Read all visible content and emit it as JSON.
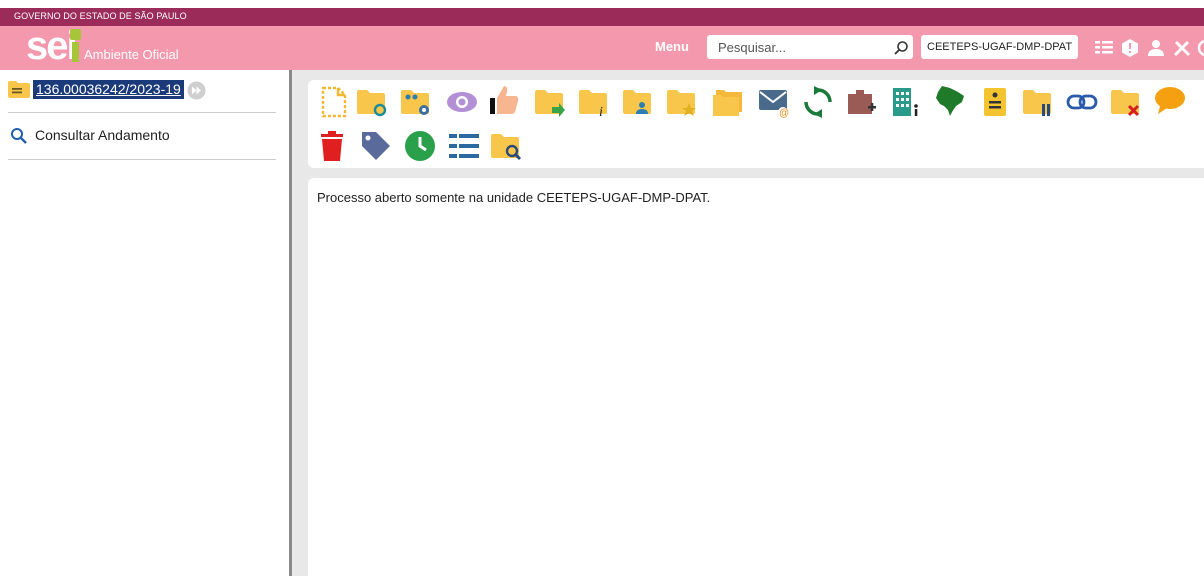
{
  "gov": {
    "label": "GOVERNO DO ESTADO DE SÃO PAULO"
  },
  "header": {
    "logo_text": "sei",
    "environment": "Ambiente Oficial",
    "menu_label": "Menu",
    "search_placeholder": "Pesquisar...",
    "unit": "CEETEPS-UGAF-DMP-DPAT",
    "icons": [
      "list-icon",
      "alert-icon",
      "user-icon",
      "tools-icon"
    ]
  },
  "sidebar": {
    "process_number": "136.00036242/2023-19",
    "consult_label": "Consultar Andamento"
  },
  "toolbar": {
    "row1": [
      "new-document-icon",
      "folder-sync-icon",
      "folder-settings-icon",
      "view-icon",
      "thumbs-up-icon",
      "folder-send-icon",
      "folder-info-icon",
      "folder-user-icon",
      "folder-star-icon",
      "folders-icon",
      "email-icon",
      "refresh-icon",
      "add-block-icon",
      "building-icon",
      "map-icon",
      "document-note-icon",
      "folder-pause-icon",
      "link-icon",
      "folder-remove-icon",
      "comment-icon"
    ],
    "row2": [
      "trash-icon",
      "tag-icon",
      "clock-icon",
      "list-view-icon",
      "folder-search-icon"
    ]
  },
  "colors": {
    "gov_bar": "#9b2c5a",
    "topbar": "#f498ad",
    "folder": "#f8c64a",
    "accent_blue": "#1a3a7a"
  },
  "content": {
    "message": "Processo aberto somente na unidade CEETEPS-UGAF-DMP-DPAT."
  }
}
